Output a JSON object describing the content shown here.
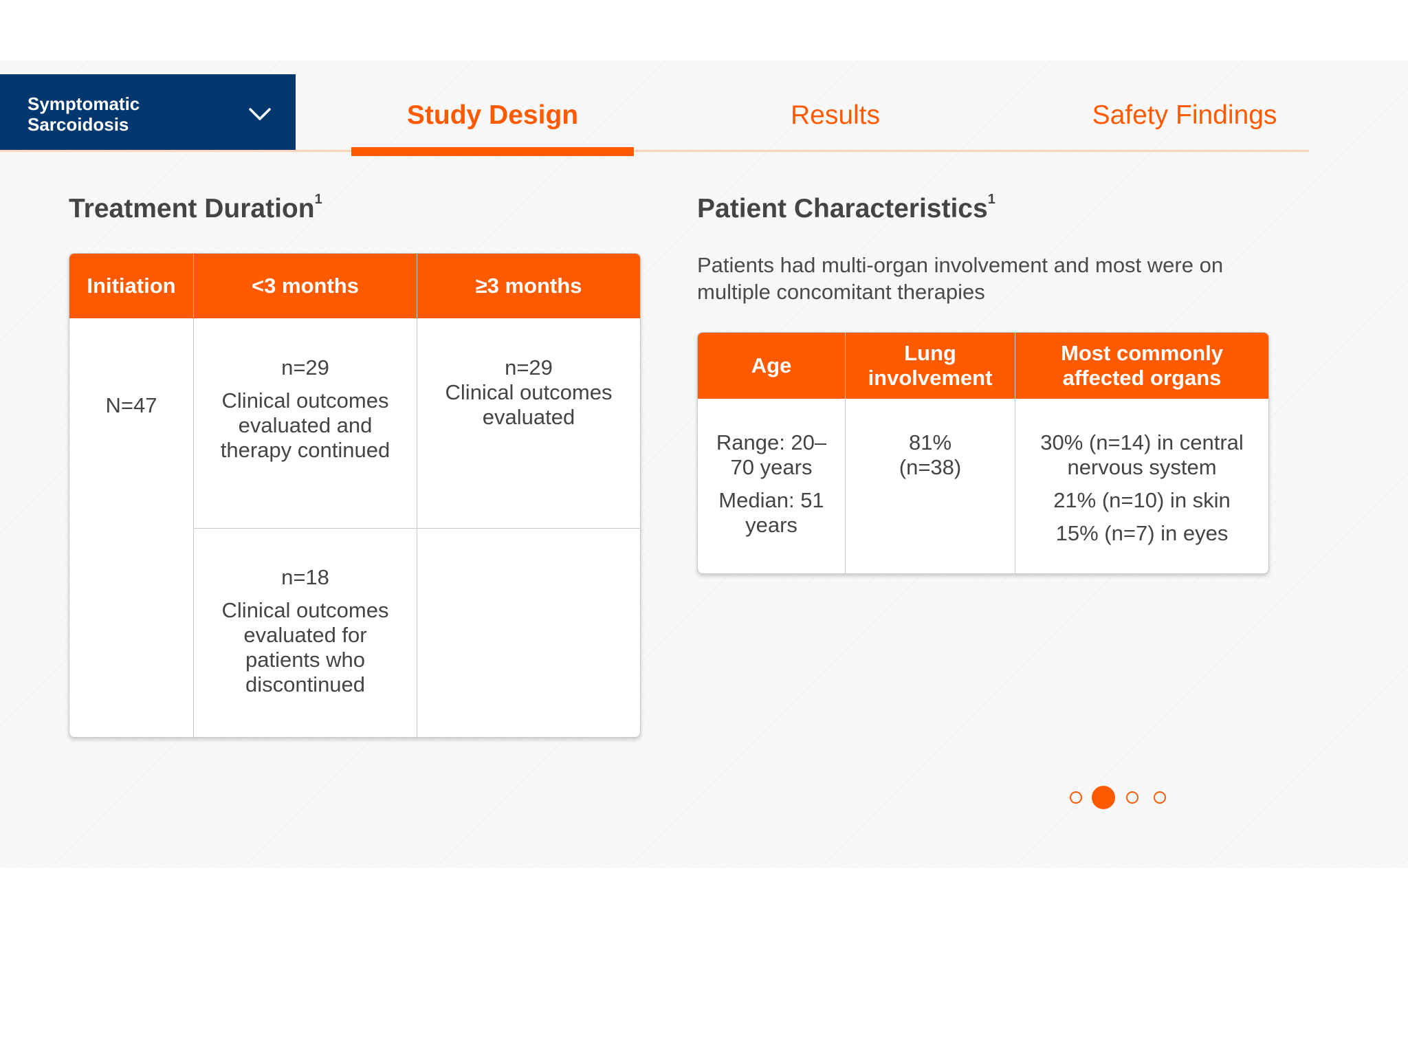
{
  "indication": {
    "label": "Symptomatic Sarcoidosis",
    "icon": "chevron-down-icon"
  },
  "tabs": [
    {
      "label": "Study Design",
      "active": true
    },
    {
      "label": "Results",
      "active": false
    },
    {
      "label": "Safety Findings",
      "active": false
    }
  ],
  "treatment_duration": {
    "title": "Treatment Duration",
    "footnote": "1",
    "headers": [
      "Initiation",
      "<3 months",
      "≥3 months"
    ],
    "initiation": "N=47",
    "lt3_row1": {
      "n": "n=29",
      "text": "Clinical outcomes evaluated and therapy continued"
    },
    "ge3_row1": {
      "n": "n=29",
      "text": "Clinical outcomes evaluated"
    },
    "lt3_row2": {
      "n": "n=18",
      "text": "Clinical outcomes evaluated for patients who discontinued"
    }
  },
  "patient_characteristics": {
    "title": "Patient Characteristics",
    "footnote": "1",
    "intro": "Patients had multi-organ involvement and most were on multiple concomitant therapies",
    "headers": [
      "Age",
      "Lung involvement",
      "Most commonly affected organs"
    ],
    "age": {
      "range": "Range: 20–70 years",
      "median": "Median: 51 years"
    },
    "lung": "81% (n=38)",
    "organs": [
      "30% (n=14) in central nervous system",
      "21% (n=10) in skin",
      "15% (n=7) in eyes"
    ]
  },
  "pagination": {
    "total": 4,
    "active_index": 1
  },
  "colors": {
    "accent": "#ff5a00",
    "navy": "#03386e",
    "text": "#444444"
  }
}
